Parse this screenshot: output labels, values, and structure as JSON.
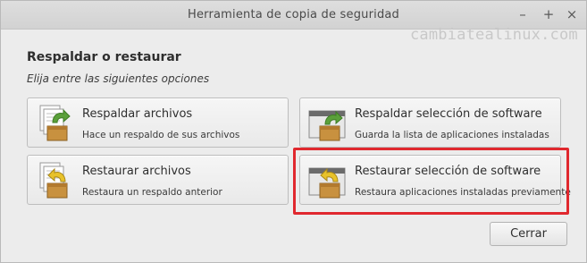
{
  "window": {
    "title": "Herramienta de copia de seguridad",
    "controls": {
      "minimize": "–",
      "maximize": "+",
      "close": "×"
    }
  },
  "watermark": "cambiatealinux.com",
  "header": {
    "title": "Respaldar o restaurar",
    "subtitle": "Elija entre las siguientes opciones"
  },
  "options": [
    {
      "title": "Respaldar archivos",
      "description": "Hace un respaldo de sus archivos",
      "icon": "backup-files-icon"
    },
    {
      "title": "Respaldar selección de software",
      "description": "Guarda la lista de aplicaciones instaladas",
      "icon": "backup-software-icon"
    },
    {
      "title": "Restaurar archivos",
      "description": "Restaura un respaldo anterior",
      "icon": "restore-files-icon"
    },
    {
      "title": "Restaurar selección de software",
      "description": "Restaura aplicaciones instaladas previamente",
      "icon": "restore-software-icon",
      "highlighted": true
    }
  ],
  "footer": {
    "close_label": "Cerrar"
  },
  "colors": {
    "highlight": "#e0282e",
    "arrow_backup": "#5aa03a",
    "arrow_restore": "#e8c22a",
    "box": "#c8913f"
  }
}
